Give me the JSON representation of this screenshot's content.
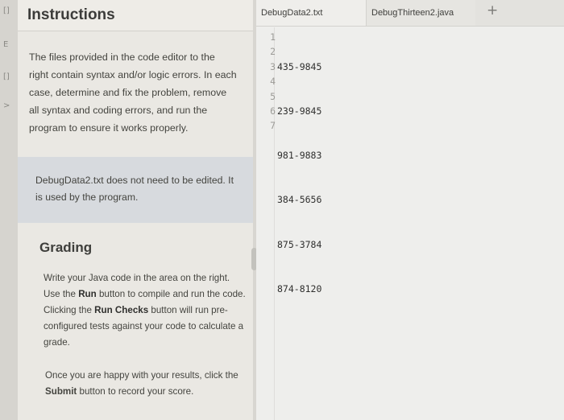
{
  "instructions": {
    "title": "Instructions",
    "body": "The files provided in the code editor to the right contain syntax and/or logic errors. In each case, determine and fix the problem, remove all syntax and coding errors, and run the program to ensure it works properly.",
    "note": "DebugData2.txt does not need to be edited. It is used by the program.",
    "grading_title": "Grading",
    "grading_p1_a": "Write your Java code in the area on the right. Use the ",
    "grading_p1_run": "Run",
    "grading_p1_b": " button to compile and run the code. Clicking the ",
    "grading_p1_checks": "Run Checks",
    "grading_p1_c": " button will run pre-configured tests against your code to calculate a grade.",
    "grading_p2_a": "Once you are happy with your results, click the ",
    "grading_p2_submit": "Submit",
    "grading_p2_b": " button to record your score."
  },
  "editor": {
    "tabs": [
      {
        "label": "DebugData2.txt",
        "active": true
      },
      {
        "label": "DebugThirteen2.java",
        "active": false
      }
    ],
    "add_tab": "+",
    "line_numbers": [
      "1",
      "2",
      "3",
      "4",
      "5",
      "6",
      "7"
    ],
    "lines": [
      "435-9845",
      "239-9845",
      "981-9883",
      "384-5656",
      "875-3784",
      "874-8120",
      ""
    ]
  },
  "side": {
    "glyphs": [
      "[]",
      "E",
      "[]",
      ">"
    ]
  }
}
